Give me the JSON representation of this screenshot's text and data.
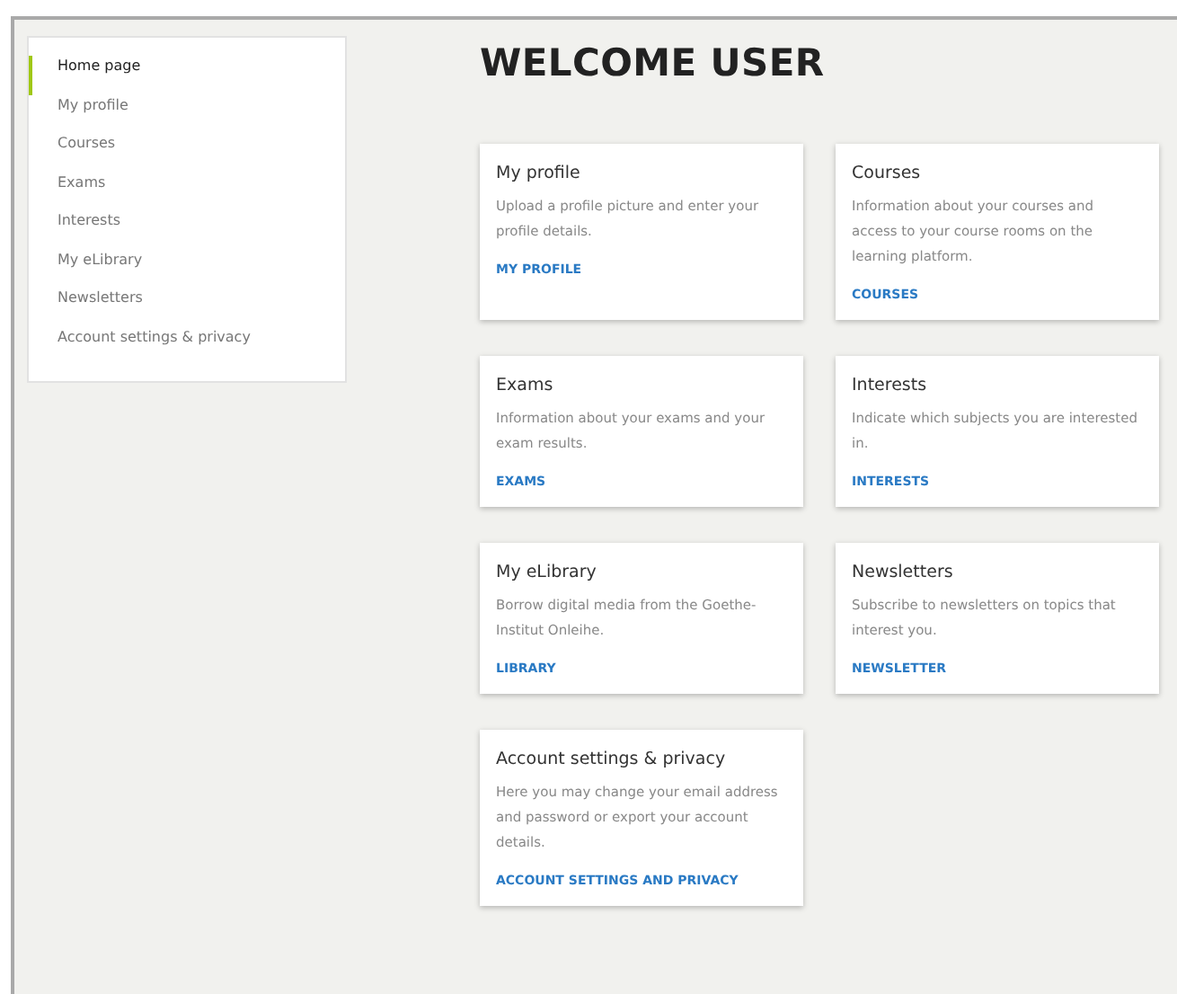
{
  "sidebar": {
    "items": [
      {
        "label": "Home page",
        "selected": true
      },
      {
        "label": "My profile",
        "selected": false
      },
      {
        "label": "Courses",
        "selected": false
      },
      {
        "label": "Exams",
        "selected": false
      },
      {
        "label": "Interests",
        "selected": false
      },
      {
        "label": "My eLibrary",
        "selected": false
      },
      {
        "label": "Newsletters",
        "selected": false
      },
      {
        "label": "Account settings & privacy",
        "selected": false
      }
    ]
  },
  "heading": "WELCOME USER",
  "cards": [
    {
      "title": "My profile",
      "text": "Upload a profile picture and enter your profile details.",
      "link": "MY PROFILE"
    },
    {
      "title": "Courses",
      "text": "Information about your courses and access to your course rooms on the learning platform.",
      "link": "COURSES"
    },
    {
      "title": "Exams",
      "text": "Information about your exams and your exam results.",
      "link": "EXAMS"
    },
    {
      "title": "Interests",
      "text": "Indicate which subjects you are interested in.",
      "link": "INTERESTS"
    },
    {
      "title": "My eLibrary",
      "text": "Borrow digital media from the Goethe-Institut Onleihe.",
      "link": "LIBRARY"
    },
    {
      "title": "Newsletters",
      "text": "Subscribe to newsletters on topics that interest you.",
      "link": "NEWSLETTER"
    },
    {
      "title": "Account settings & privacy",
      "text": "Here you may change your email address and password or export your account details.",
      "link": "ACCOUNT SETTINGS AND PRIVACY"
    }
  ]
}
